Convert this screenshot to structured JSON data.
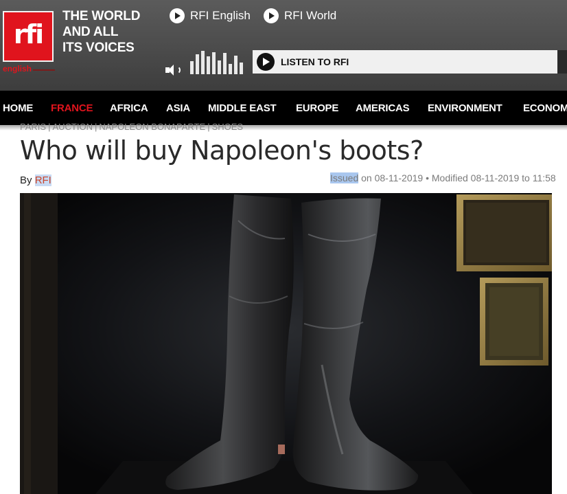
{
  "header": {
    "logo_text": "rfi",
    "logo_sub": "english",
    "tagline": [
      "THE WORLD",
      "AND ALL",
      "ITS VOICES"
    ],
    "radio_links": [
      "RFI English",
      "RFI World"
    ],
    "listen_label": "LISTEN TO RFI",
    "volume_icon": "volume-icon",
    "equalizer_levels": [
      0.55,
      0.85,
      1.0,
      0.75,
      0.95,
      0.6,
      0.9,
      0.45,
      0.8,
      0.5
    ]
  },
  "nav": {
    "items": [
      "HOME",
      "FRANCE",
      "AFRICA",
      "ASIA",
      "MIDDLE EAST",
      "EUROPE",
      "AMERICAS",
      "ENVIRONMENT",
      "ECONOMY"
    ],
    "active": "FRANCE"
  },
  "article": {
    "breadcrumb": [
      "PARIS",
      "AUCTION",
      "NAPOLEON BONAPARTE",
      "SHOES"
    ],
    "title": "Who will buy Napoleon's boots?",
    "byline_prefix": "By",
    "author": "RFI",
    "issued_word": "Issued",
    "issued_rest": " on 08-11-2019",
    "modified": " • Modified 08-11-2019 to 11:58",
    "image_subject": "napoleon-boots-photo"
  },
  "colors": {
    "brand_red": "#e0141d",
    "nav_bg": "#000000",
    "header_bg": "#4b4b4b",
    "selection": "#a9c7ef"
  }
}
